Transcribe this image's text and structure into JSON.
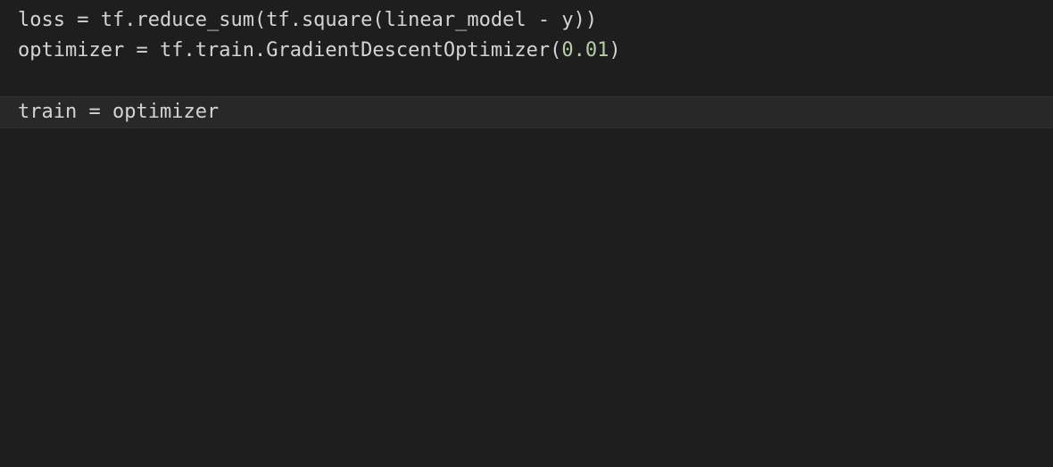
{
  "code": {
    "line1": {
      "v_loss": "loss",
      "eq1": " = ",
      "tf1": "tf",
      "dot1": ".",
      "reduce_sum": "reduce_sum",
      "open1": "(",
      "tf2": "tf",
      "dot2": ".",
      "square": "square",
      "open2": "(",
      "linear_model": "linear_model",
      "minus": " - ",
      "y": "y",
      "close1": ")",
      "close2": ")"
    },
    "line2": {
      "v_opt": "optimizer",
      "eq": " = ",
      "tf": "tf",
      "dot1": ".",
      "train": "train",
      "dot2": ".",
      "cls": "GradientDescentOptimizer",
      "open": "(",
      "rate": "0.01",
      "close": ")"
    },
    "line3_blank": "",
    "line4": {
      "v_train": "train",
      "eq": " = ",
      "opt": "optimizer"
    }
  }
}
